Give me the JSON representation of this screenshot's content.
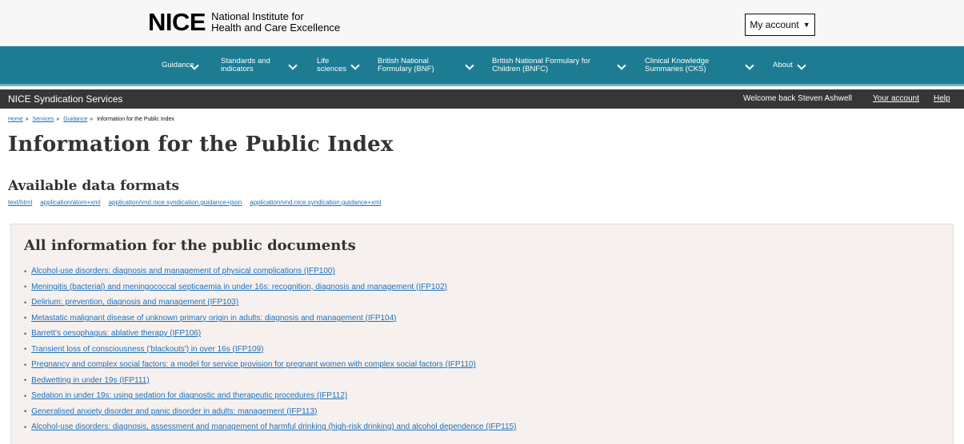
{
  "header": {
    "logo_mark": "NICE",
    "logo_line1": "National Institute for",
    "logo_line2": "Health and Care Excellence",
    "account_label": "My account",
    "account_caret": "▼"
  },
  "nav": {
    "items": [
      {
        "line1": "Guidance",
        "line2": ""
      },
      {
        "line1": "Standards and",
        "line2": "indicators"
      },
      {
        "line1": "Life",
        "line2": "sciences"
      },
      {
        "line1": "British National",
        "line2": "Formulary (BNF)"
      },
      {
        "line1": "British National Formulary for",
        "line2": "Children (BNFC)"
      },
      {
        "line1": "Clinical Knowledge",
        "line2": "Summaries (CKS)"
      },
      {
        "line1": "About",
        "line2": ""
      }
    ],
    "chevron_icon": "chevron-down-icon",
    "bg_color": "#1d7c92"
  },
  "syndication": {
    "title": "NICE Syndication Services",
    "welcome": "Welcome back Steven Ashwell",
    "your_account": "Your account",
    "help": "Help"
  },
  "breadcrumb": {
    "home": "Home",
    "services": "Services",
    "guidance": "Guidance",
    "current": "Information for the Public Index",
    "separator": "»"
  },
  "page": {
    "title": "Information for the Public Index",
    "formats_heading": "Available data formats",
    "formats": [
      "text/html",
      "application/atom+xml",
      "application/vnd.nice.syndication.guidance+json",
      "application/vnd.nice.syndication.guidance+xml"
    ]
  },
  "documents": {
    "heading": "All information for the public documents",
    "bullet": "•",
    "items": [
      "Alcohol-use disorders: diagnosis and management of physical complications (IFP100)",
      "Meningitis (bacterial) and meningococcal septicaemia in under 16s: recognition, diagnosis and management (IFP102)",
      "Delirium: prevention, diagnosis and management (IFP103)",
      "Metastatic malignant disease of unknown primary origin in adults: diagnosis and management (IFP104)",
      "Barrett's oesophagus: ablative therapy (IFP106)",
      "Transient loss of consciousness ('blackouts') in over 16s (IFP109)",
      "Pregnancy and complex social factors: a model for service provision for pregnant women with complex social factors (IFP110)",
      "Bedwetting in under 19s (IFP111)",
      "Sedation in under 19s: using sedation for diagnostic and therapeutic procedures (IFP112)",
      "Generalised anxiety disorder and panic disorder in adults: management (IFP113)",
      "Alcohol-use disorders: diagnosis, assessment and management of harmful drinking (high-risk drinking) and alcohol dependence (IFP115)"
    ]
  }
}
